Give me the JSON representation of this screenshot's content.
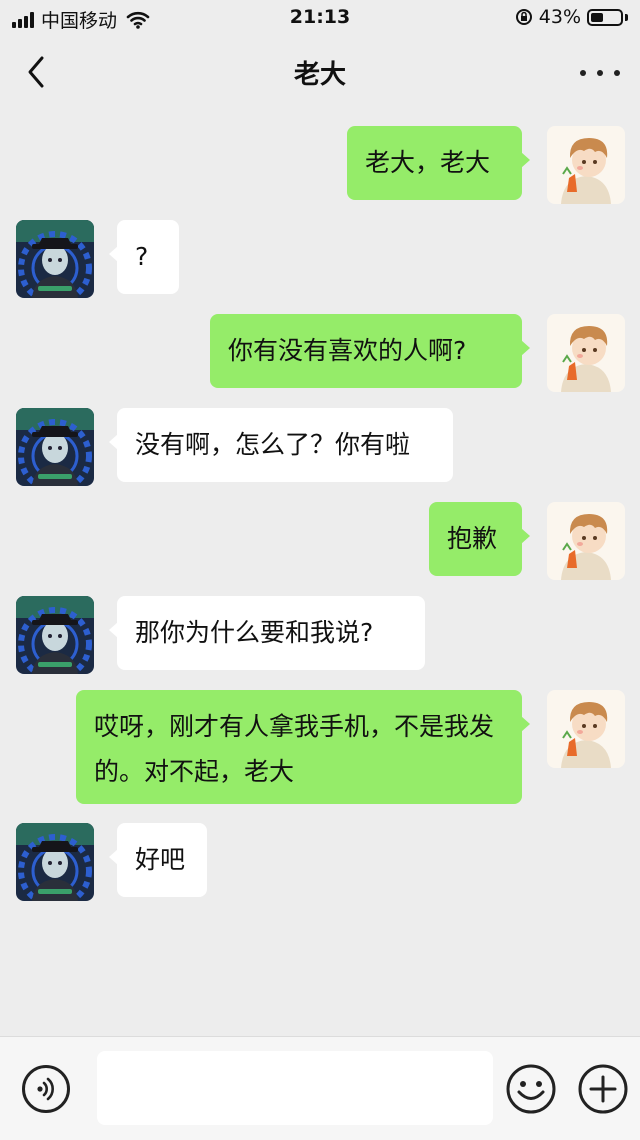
{
  "status_bar": {
    "carrier": "中国移动",
    "time": "21:13",
    "battery_percent": "43%",
    "battery_level": 0.43,
    "icons": [
      "signal-icon",
      "wifi-icon",
      "rotation-lock-icon",
      "battery-icon"
    ]
  },
  "nav": {
    "title": "老大",
    "back_icon": "chevron-left-icon",
    "more_icon": "more-dots-icon"
  },
  "messages": [
    {
      "side": "right",
      "text": "老大，老大"
    },
    {
      "side": "left",
      "text": "?"
    },
    {
      "side": "right",
      "text": "你有没有喜欢的人啊?"
    },
    {
      "side": "left",
      "text": "没有啊，怎么了？你有啦"
    },
    {
      "side": "right",
      "text": "抱歉"
    },
    {
      "side": "left",
      "text": "那你为什么要和我说?"
    },
    {
      "side": "right",
      "text": "哎呀，刚才有人拿我手机，不是我发的。对不起，老大"
    },
    {
      "side": "left",
      "text": "好吧"
    }
  ],
  "input_bar": {
    "voice_icon": "voice-icon",
    "emoji_icon": "emoji-icon",
    "plus_icon": "plus-circle-icon",
    "input_value": "",
    "input_placeholder": ""
  },
  "colors": {
    "background": "#ededed",
    "self_bubble": "#95ec69",
    "other_bubble": "#ffffff"
  }
}
